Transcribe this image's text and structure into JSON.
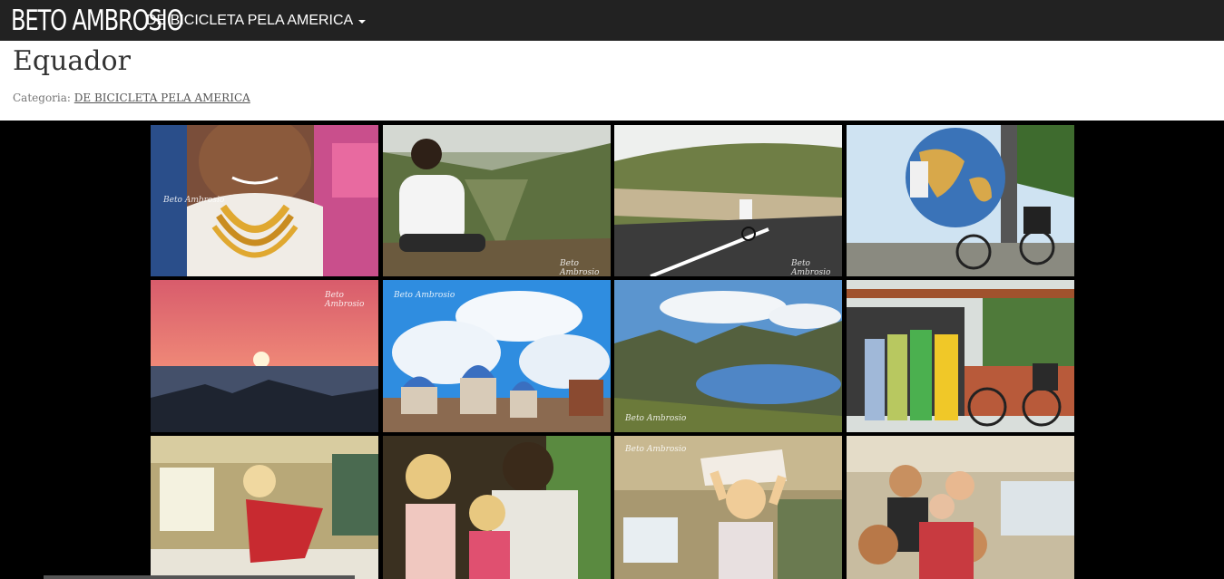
{
  "brand": "BETO AMBROSIO",
  "nav": {
    "menu_label": "DE BICICLETA PELA AMERICA"
  },
  "page": {
    "title": "Equador",
    "category_label": "Categoria:",
    "category_link": "DE BICICLETA PELA AMERICA"
  },
  "photos": [
    {
      "name": "photo-elderly-woman-necklaces",
      "signature": "Beto Ambrosio"
    },
    {
      "name": "photo-man-sitting-canyon",
      "signature": "Beto Ambrosio"
    },
    {
      "name": "photo-cyclist-mountain-road",
      "signature": "Beto Ambrosio"
    },
    {
      "name": "photo-globe-monument-bicycle",
      "signature": ""
    },
    {
      "name": "photo-sunset-ocean-rocks",
      "signature": "Beto Ambrosio"
    },
    {
      "name": "photo-blue-domes-cathedral",
      "signature": "Beto Ambrosio"
    },
    {
      "name": "photo-mountain-lake",
      "signature": "Beto Ambrosio"
    },
    {
      "name": "photo-group-with-bicycle",
      "signature": ""
    },
    {
      "name": "photo-girl-in-van",
      "signature": ""
    },
    {
      "name": "photo-girls-with-man-reading",
      "signature": ""
    },
    {
      "name": "photo-girl-book-on-head",
      "signature": "Beto Ambrosio"
    },
    {
      "name": "photo-group-in-van",
      "signature": ""
    }
  ]
}
